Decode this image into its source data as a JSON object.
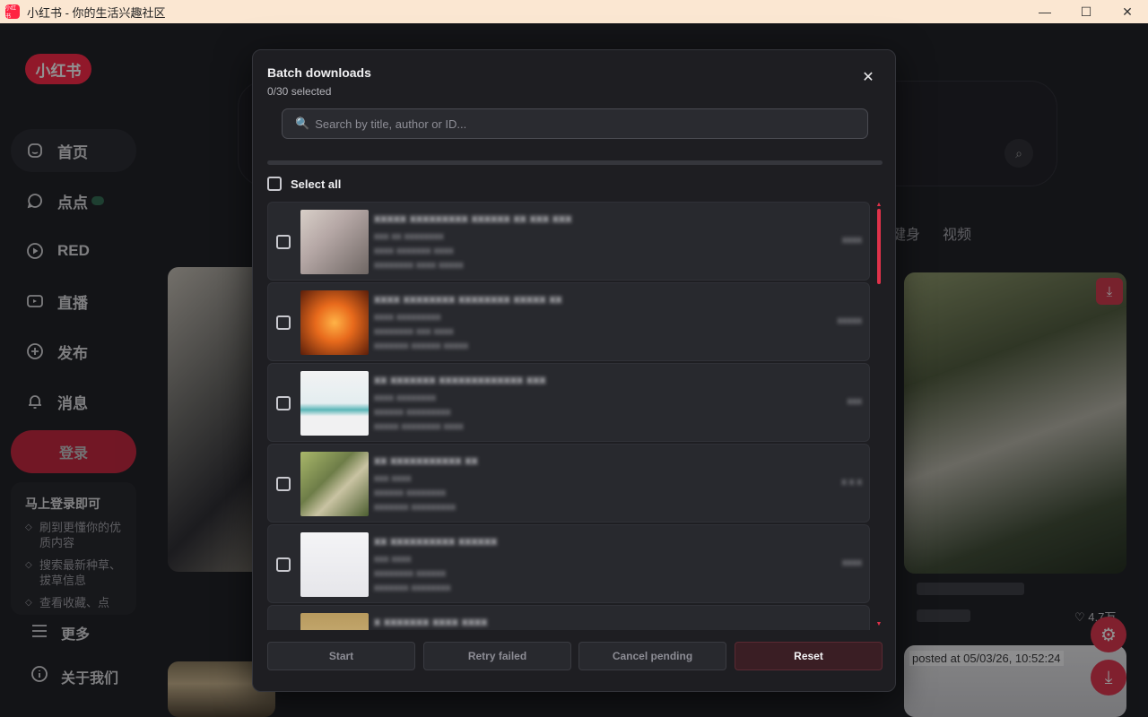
{
  "window": {
    "title": "小红书 - 你的生活兴趣社区",
    "minimize": "—",
    "maximize": "☐",
    "close": "✕"
  },
  "app": {
    "logo": "小红书",
    "nav": [
      {
        "label": "首页",
        "icon": "home-icon"
      },
      {
        "label": "点点",
        "icon": "chat-bubble-icon"
      },
      {
        "label": "RED",
        "icon": "play-circle-icon"
      },
      {
        "label": "直播",
        "icon": "live-camera-icon"
      },
      {
        "label": "发布",
        "icon": "plus-square-icon"
      },
      {
        "label": "消息",
        "icon": "bell-icon"
      }
    ],
    "login_button": "登录",
    "login_card": {
      "title": "马上登录即可",
      "items": [
        "刷到更懂你的优质内容",
        "搜索最新种草、拔草信息",
        "查看收藏、点"
      ]
    },
    "more": "更多",
    "about": "关于我们",
    "channels": [
      "健身",
      "视频"
    ],
    "posted_label": "posted at 05/03/26, 10:52:24",
    "likes": "♡ 4.7万"
  },
  "modal": {
    "title": "Batch downloads",
    "selected_count": "0/30 selected",
    "search_placeholder": "Search by title, author or ID...",
    "select_all_label": "Select all",
    "progress": 0,
    "rows": [
      {
        "title": "xxxxx xxxxxxxxx xxxxxx xx xxx xxx",
        "line1": "xxx xx xxxxxxxx",
        "line2": "xxxx xxxxxxx xxxx",
        "line3": "xxxxxxxx xxxx xxxxx",
        "status": "xxxx"
      },
      {
        "title": "xxxx xxxxxxxx xxxxxxxx xxxxx xx",
        "line1": "xxxx xxxxxxxxx",
        "line2": "xxxxxxxx xxx xxxx",
        "line3": "xxxxxxx xxxxxx xxxxx",
        "status": "xxxxx"
      },
      {
        "title": "xx xxxxxxx xxxxxxxxxxxxx xxx",
        "line1": "xxxx xxxxxxxx",
        "line2": "xxxxxx xxxxxxxxx",
        "line3": "xxxxx xxxxxxxx xxxx",
        "status": "xxx"
      },
      {
        "title": "xx xxxxxxxxxxx xx",
        "line1": "xxx xxxx",
        "line2": "xxxxxx xxxxxxxx",
        "line3": "xxxxxxx xxxxxxxxx",
        "status": "x x x"
      },
      {
        "title": "xx xxxxxxxxxx xxxxxx",
        "line1": "xxx xxxx",
        "line2": "xxxxxxxx xxxxxx",
        "line3": "xxxxxxx xxxxxxxx",
        "status": "xxxx"
      },
      {
        "title": "x xxxxxxx xxxx xxxx",
        "line1": "",
        "line2": "",
        "line3": "",
        "status": ""
      }
    ],
    "buttons": {
      "start": "Start",
      "retry": "Retry failed",
      "cancel": "Cancel pending",
      "reset": "Reset"
    }
  },
  "colors": {
    "accent": "#e0324a",
    "modal_bg": "#1e1e22",
    "titlebar_bg": "#fbe7d2"
  }
}
